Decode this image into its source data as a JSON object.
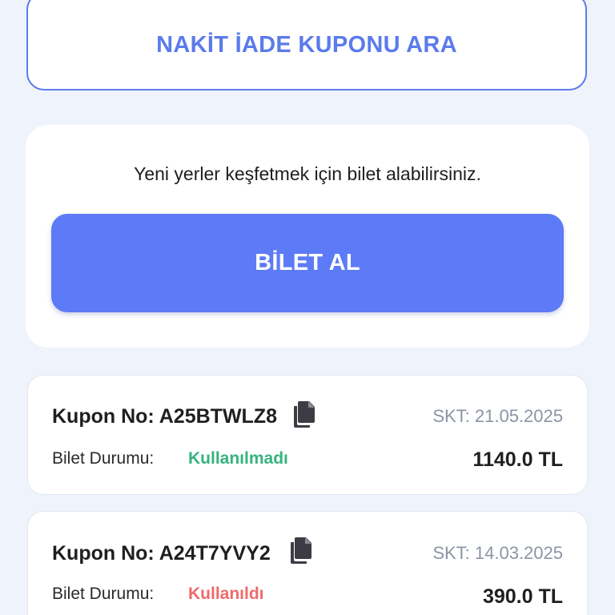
{
  "search_button": {
    "label": "NAKİT İADE KUPONU ARA"
  },
  "promo": {
    "text": "Yeni yerler keşfetmek için bilet alabilirsiniz.",
    "buy_label": "BİLET AL"
  },
  "coupons": [
    {
      "label": "Kupon No: A25BTWLZ8",
      "expiry": "SKT: 21.05.2025",
      "status_label": "Bilet Durumu:",
      "status": "Kullanılmadı",
      "status_color": "#36b37e",
      "price": "1140.0 TL",
      "copy_icon": "copy-icon"
    },
    {
      "label": "Kupon No: A24T7YVY2",
      "expiry": "SKT: 14.03.2025",
      "status_label": "Bilet Durumu:",
      "status": "Kullanıldı",
      "status_color": "#ef6a6a",
      "price": "390.0 TL",
      "copy_icon": "copy-icon"
    }
  ],
  "colors": {
    "accent": "#5d7bf6",
    "background": "#eff3fb",
    "used": "#ef6a6a",
    "unused": "#36b37e"
  }
}
